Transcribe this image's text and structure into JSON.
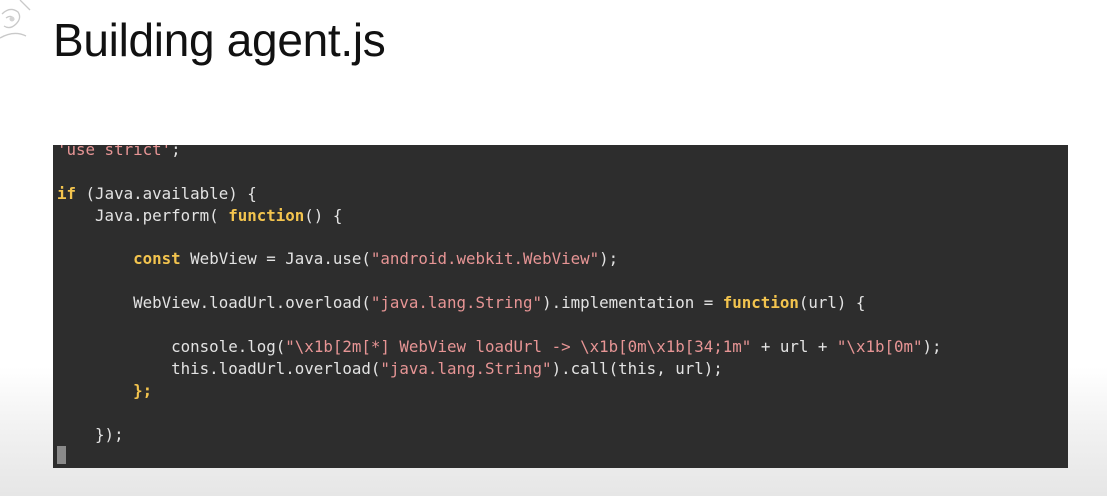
{
  "slide": {
    "title": "Building agent.js"
  },
  "code": {
    "line01": {
      "str": "'use strict'",
      "plain": ";"
    },
    "line03": {
      "kw": "if",
      "plain": " (Java.available) {"
    },
    "line04": {
      "plain1": "Java.perform( ",
      "kw": "function",
      "plain2": "() {"
    },
    "line06": {
      "kw": "const",
      "plain1": " WebView = Java.use(",
      "str": "\"android.webkit.WebView\"",
      "plain2": ");"
    },
    "line08": {
      "plain1": "WebView.loadUrl.overload(",
      "str": "\"java.lang.String\"",
      "plain2": ").implementation = ",
      "kw": "function",
      "plain3": "(url) {"
    },
    "line10": {
      "plain1": "console.log(",
      "str1": "\"\\x1b[2m[*] WebView loadUrl -> \\x1b[0m\\x1b[34;1m\"",
      "plain2": " + url + ",
      "str2": "\"\\x1b[0m\"",
      "plain3": ");"
    },
    "line11": {
      "plain1": "this.loadUrl.overload(",
      "str": "\"java.lang.String\"",
      "plain2": ").call(this, url);"
    },
    "line12": {
      "kw": "};"
    },
    "line14": {
      "plain": "});"
    }
  },
  "colors": {
    "terminal_bg": "#2d2d2d",
    "keyword": "#f3c44e",
    "string": "#e79595",
    "plain": "#e3e3e3"
  },
  "icons": {
    "corner_logo": "decorative-logo-icon"
  }
}
